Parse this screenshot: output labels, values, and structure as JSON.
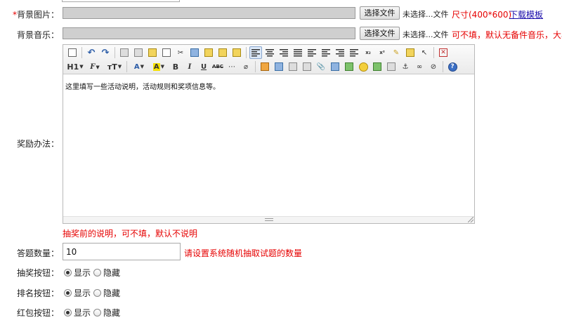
{
  "bg_image": {
    "required_mark": "*",
    "label": "背景图片：",
    "button": "选择文件",
    "status": "未选择...文件",
    "hint": "尺寸(400*600)",
    "link": "下载模板"
  },
  "bg_music": {
    "label": "背景音乐：",
    "button": "选择文件",
    "status": "未选择...文件",
    "hint": "可不填，默认无备件音乐，大小"
  },
  "reward": {
    "label": "奖励办法：",
    "content": "这里填写一些活动说明，活动规则和奖项信息等。",
    "hint": "抽奖前的说明，可不填，默认不说明"
  },
  "toolbar": {
    "heading": "H1",
    "font_family": "F",
    "font_size": "тT",
    "font_color": "A",
    "bg_color": "A",
    "bold": "B",
    "italic": "I",
    "underline": "U",
    "strike": "ABC",
    "help": "?",
    "subscript": "x₂",
    "superscript": "x²"
  },
  "question_count": {
    "label": "答题数量：",
    "value": "10",
    "hint": "请设置系统随机抽取试题的数量"
  },
  "lottery_button": {
    "label": "抽奖按钮：",
    "opt_show": "显示",
    "opt_hide": "隐藏",
    "selected": "show"
  },
  "rank_button": {
    "label": "排名按钮：",
    "opt_show": "显示",
    "opt_hide": "隐藏",
    "selected": "show"
  },
  "redpacket_button": {
    "label": "红包按钮：",
    "opt_show": "显示",
    "opt_hide": "隐藏",
    "selected": "show"
  }
}
